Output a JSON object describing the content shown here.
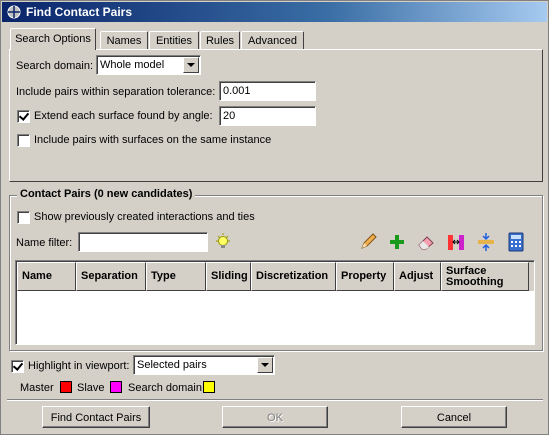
{
  "window": {
    "title": "Find Contact Pairs"
  },
  "tabs": [
    {
      "label": "Search Options",
      "active": true
    },
    {
      "label": "Names"
    },
    {
      "label": "Entities"
    },
    {
      "label": "Rules"
    },
    {
      "label": "Advanced"
    }
  ],
  "search_options": {
    "domain_label": "Search domain:",
    "domain_value": "Whole model",
    "tolerance_label": "Include pairs within separation tolerance:",
    "tolerance_value": "0.001",
    "extend_label": "Extend each surface found by angle:",
    "extend_checked": true,
    "extend_value": "20",
    "same_instance_label": "Include pairs with surfaces on the same instance",
    "same_instance_checked": false
  },
  "contact_pairs": {
    "group_title": "Contact Pairs (0 new candidates)",
    "show_previous_label": "Show previously created interactions and ties",
    "show_previous_checked": false,
    "name_filter_label": "Name filter:",
    "name_filter_value": "",
    "toolbar_icons": [
      "highlight-bulb-icon",
      "edit-pencil-icon",
      "add-icon",
      "eraser-icon",
      "switch-master-slave-icon",
      "adjust-icon",
      "calculator-icon"
    ],
    "columns": [
      "Name",
      "Separation",
      "Type",
      "Sliding",
      "Discretization",
      "Property",
      "Adjust",
      "Surface Smoothing"
    ],
    "rows": []
  },
  "highlight": {
    "label": "Highlight in viewport:",
    "checked": true,
    "select_value": "Selected pairs"
  },
  "legend": {
    "items": [
      {
        "label": "Master",
        "color": "#ff0000"
      },
      {
        "label": "Slave",
        "color": "#ff00ff"
      },
      {
        "label": "Search domain",
        "color": "#ffff00"
      }
    ]
  },
  "buttons": {
    "find": "Find Contact Pairs",
    "ok": "OK",
    "cancel": "Cancel"
  }
}
